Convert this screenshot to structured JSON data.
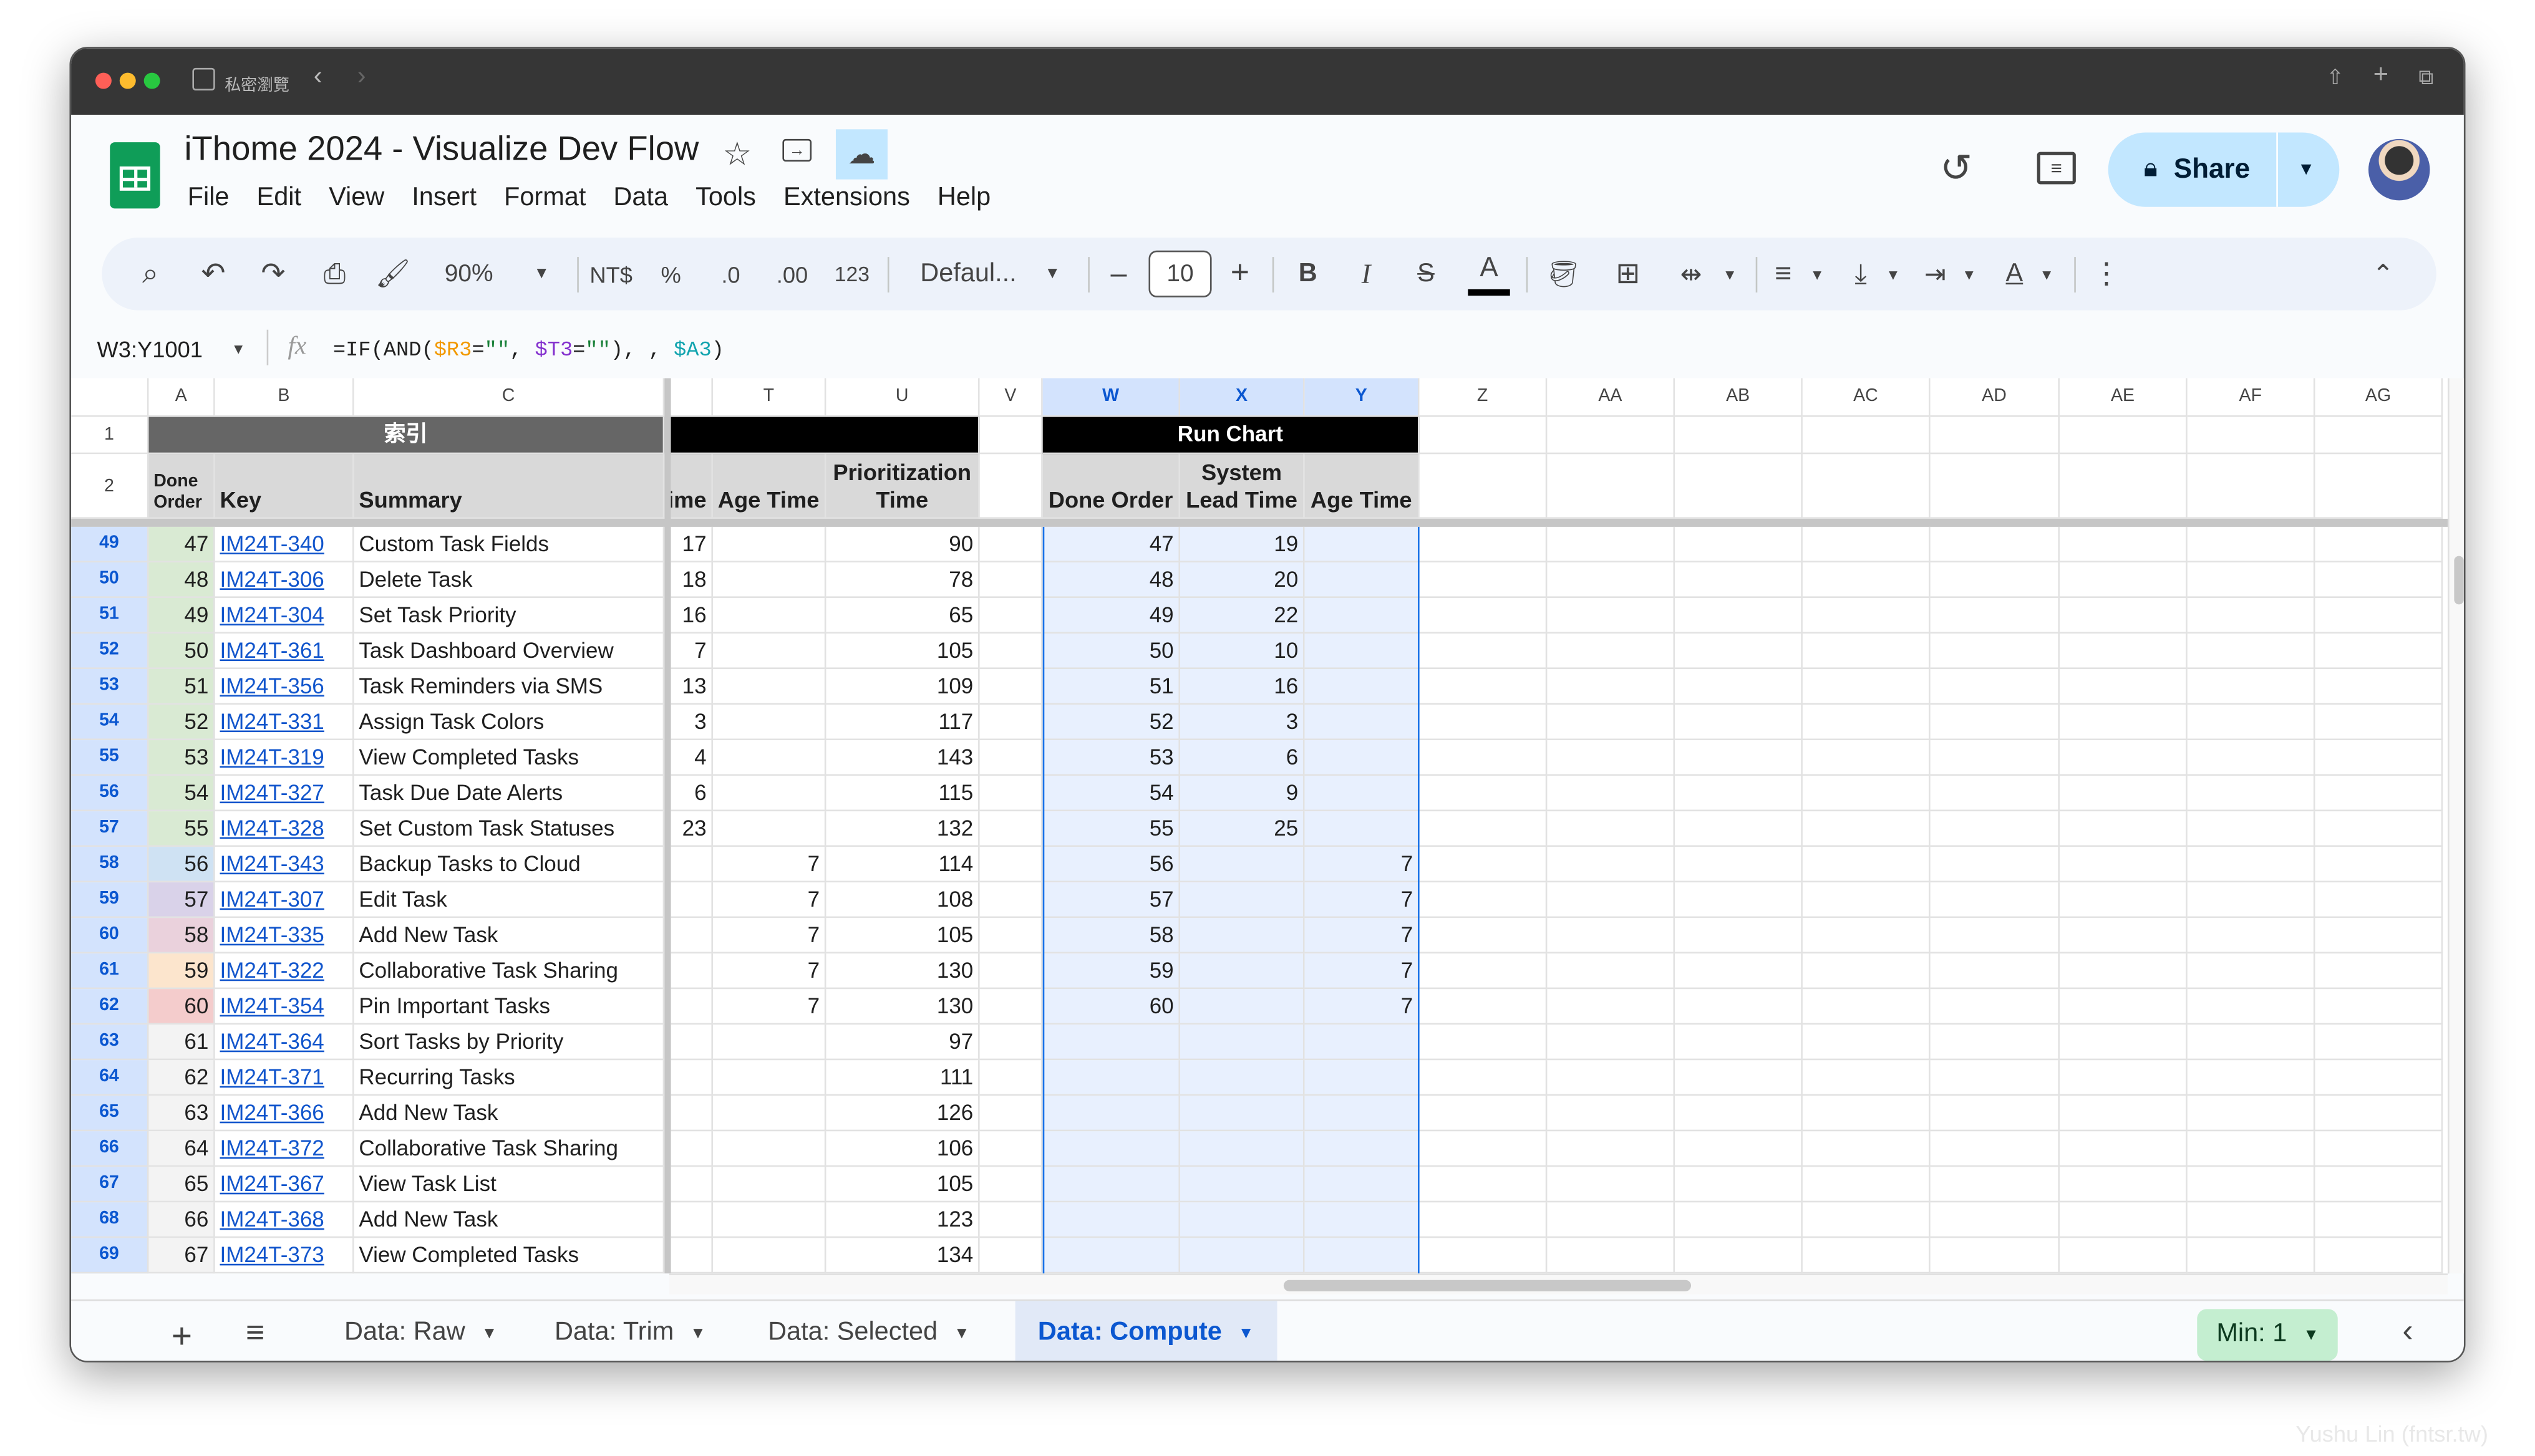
{
  "browser": {
    "private_label": "私密瀏覽"
  },
  "doc": {
    "title": "iThome 2024 - Visualize Dev Flow",
    "menus": [
      "File",
      "Edit",
      "View",
      "Insert",
      "Format",
      "Data",
      "Tools",
      "Extensions",
      "Help"
    ],
    "share_label": "Share"
  },
  "toolbar": {
    "zoom": "90%",
    "currency": "NT$",
    "percent": "%",
    "dec_decrease": ".0",
    "dec_increase": ".00",
    "number_format": "123",
    "font": "Defaul...",
    "font_size": "10",
    "bold": "B",
    "italic": "I",
    "strike": "S",
    "text_color": "A"
  },
  "formula_bar": {
    "name_box": "W3:Y1001",
    "fx": "fx",
    "formula_parts": [
      {
        "t": "=IF(AND(",
        "c": "#1f1f1f"
      },
      {
        "t": "$R3",
        "c": "#f29900"
      },
      {
        "t": "=",
        "c": "#1f1f1f"
      },
      {
        "t": "\"\"",
        "c": "#188038"
      },
      {
        "t": ", ",
        "c": "#1f1f1f"
      },
      {
        "t": "$T3",
        "c": "#8430ce"
      },
      {
        "t": "=",
        "c": "#1f1f1f"
      },
      {
        "t": "\"\"",
        "c": "#188038"
      },
      {
        "t": "), , ",
        "c": "#1f1f1f"
      },
      {
        "t": "$A3",
        "c": "#12a4af"
      },
      {
        "t": ")",
        "c": "#1f1f1f"
      }
    ]
  },
  "grid": {
    "column_headers": [
      "A",
      "B",
      "C",
      "",
      "T",
      "U",
      "V",
      "W",
      "X",
      "Y",
      "Z",
      "AA",
      "AB",
      "AC",
      "AD",
      "AE",
      "AF",
      "AG"
    ],
    "row1": {
      "index_title": "索引",
      "run_chart_title": "Run Chart"
    },
    "row2": {
      "A": "Done Order",
      "B": "Key",
      "C": "Summary",
      "S": "ime",
      "T": "Age Time",
      "U": "Prioritization Time",
      "W": "Done Order",
      "X": "System Lead Time",
      "Y": "Age Time"
    },
    "rows": [
      {
        "n": "49",
        "a": "47",
        "key": "IM24T-340",
        "summary": "Custom Task Fields",
        "s": "17",
        "t": "",
        "u": "90",
        "w": "47",
        "x": "19",
        "y": "",
        "color": "#d9ead3"
      },
      {
        "n": "50",
        "a": "48",
        "key": "IM24T-306",
        "summary": "Delete Task",
        "s": "18",
        "t": "",
        "u": "78",
        "w": "48",
        "x": "20",
        "y": "",
        "color": "#d9ead3"
      },
      {
        "n": "51",
        "a": "49",
        "key": "IM24T-304",
        "summary": "Set Task Priority",
        "s": "16",
        "t": "",
        "u": "65",
        "w": "49",
        "x": "22",
        "y": "",
        "color": "#d9ead3"
      },
      {
        "n": "52",
        "a": "50",
        "key": "IM24T-361",
        "summary": "Task Dashboard Overview",
        "s": "7",
        "t": "",
        "u": "105",
        "w": "50",
        "x": "10",
        "y": "",
        "color": "#d9ead3"
      },
      {
        "n": "53",
        "a": "51",
        "key": "IM24T-356",
        "summary": "Task Reminders via SMS",
        "s": "13",
        "t": "",
        "u": "109",
        "w": "51",
        "x": "16",
        "y": "",
        "color": "#d9ead3"
      },
      {
        "n": "54",
        "a": "52",
        "key": "IM24T-331",
        "summary": "Assign Task Colors",
        "s": "3",
        "t": "",
        "u": "117",
        "w": "52",
        "x": "3",
        "y": "",
        "color": "#d9ead3"
      },
      {
        "n": "55",
        "a": "53",
        "key": "IM24T-319",
        "summary": "View Completed Tasks",
        "s": "4",
        "t": "",
        "u": "143",
        "w": "53",
        "x": "6",
        "y": "",
        "color": "#d9ead3"
      },
      {
        "n": "56",
        "a": "54",
        "key": "IM24T-327",
        "summary": "Task Due Date Alerts",
        "s": "6",
        "t": "",
        "u": "115",
        "w": "54",
        "x": "9",
        "y": "",
        "color": "#d9ead3"
      },
      {
        "n": "57",
        "a": "55",
        "key": "IM24T-328",
        "summary": "Set Custom Task Statuses",
        "s": "23",
        "t": "",
        "u": "132",
        "w": "55",
        "x": "25",
        "y": "",
        "color": "#d9ead3"
      },
      {
        "n": "58",
        "a": "56",
        "key": "IM24T-343",
        "summary": "Backup Tasks to Cloud",
        "s": "",
        "t": "7",
        "u": "114",
        "w": "56",
        "x": "",
        "y": "7",
        "color": "#cfe2f3"
      },
      {
        "n": "59",
        "a": "57",
        "key": "IM24T-307",
        "summary": "Edit Task",
        "s": "",
        "t": "7",
        "u": "108",
        "w": "57",
        "x": "",
        "y": "7",
        "color": "#d9d2e9"
      },
      {
        "n": "60",
        "a": "58",
        "key": "IM24T-335",
        "summary": "Add New Task",
        "s": "",
        "t": "7",
        "u": "105",
        "w": "58",
        "x": "",
        "y": "7",
        "color": "#ead1dc"
      },
      {
        "n": "61",
        "a": "59",
        "key": "IM24T-322",
        "summary": "Collaborative Task Sharing",
        "s": "",
        "t": "7",
        "u": "130",
        "w": "59",
        "x": "",
        "y": "7",
        "color": "#fce5cd"
      },
      {
        "n": "62",
        "a": "60",
        "key": "IM24T-354",
        "summary": "Pin Important Tasks",
        "s": "",
        "t": "7",
        "u": "130",
        "w": "60",
        "x": "",
        "y": "7",
        "color": "#f4cccc"
      },
      {
        "n": "63",
        "a": "61",
        "key": "IM24T-364",
        "summary": "Sort Tasks by Priority",
        "s": "",
        "t": "",
        "u": "97",
        "w": "",
        "x": "",
        "y": "",
        "color": "#f3f3f3"
      },
      {
        "n": "64",
        "a": "62",
        "key": "IM24T-371",
        "summary": "Recurring Tasks",
        "s": "",
        "t": "",
        "u": "111",
        "w": "",
        "x": "",
        "y": "",
        "color": "#f3f3f3"
      },
      {
        "n": "65",
        "a": "63",
        "key": "IM24T-366",
        "summary": "Add New Task",
        "s": "",
        "t": "",
        "u": "126",
        "w": "",
        "x": "",
        "y": "",
        "color": "#f3f3f3"
      },
      {
        "n": "66",
        "a": "64",
        "key": "IM24T-372",
        "summary": "Collaborative Task Sharing",
        "s": "",
        "t": "",
        "u": "106",
        "w": "",
        "x": "",
        "y": "",
        "color": "#f3f3f3"
      },
      {
        "n": "67",
        "a": "65",
        "key": "IM24T-367",
        "summary": "View Task List",
        "s": "",
        "t": "",
        "u": "105",
        "w": "",
        "x": "",
        "y": "",
        "color": "#f3f3f3"
      },
      {
        "n": "68",
        "a": "66",
        "key": "IM24T-368",
        "summary": "Add New Task",
        "s": "",
        "t": "",
        "u": "123",
        "w": "",
        "x": "",
        "y": "",
        "color": "#f3f3f3"
      },
      {
        "n": "69",
        "a": "67",
        "key": "IM24T-373",
        "summary": "View Completed Tasks",
        "s": "",
        "t": "",
        "u": "134",
        "w": "",
        "x": "",
        "y": "",
        "color": "#f3f3f3"
      }
    ]
  },
  "sheets": {
    "tabs": [
      "Data: Raw",
      "Data: Trim",
      "Data: Selected",
      "Data: Compute"
    ],
    "active": "Data: Compute",
    "summary_chip": "Min: 1"
  },
  "watermark": "Yushu Lin (fntsr.tw)",
  "colors": {
    "accent": "#0b57d0",
    "selection": "#e8f0fe",
    "selection_border": "#1a73e8",
    "share_bg": "#c2e7ff",
    "chip_bg": "#c4eed0"
  }
}
